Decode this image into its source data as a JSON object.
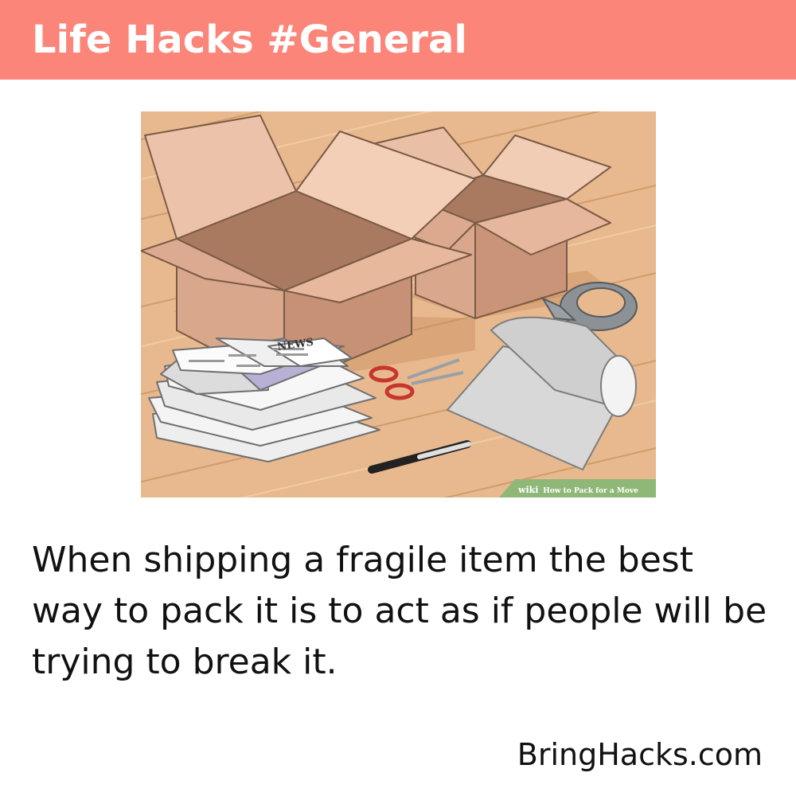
{
  "header": {
    "title": "Life Hacks #General",
    "color": "#fc857a"
  },
  "illustration": {
    "watermark_brand": "wiki",
    "watermark_text": "How to Pack for a Move",
    "newspaper_masthead": "NEWS"
  },
  "hack": {
    "text": "When shipping a fragile item the best way to pack it is to act as if people will be trying to break it."
  },
  "footer": {
    "site": "BringHacks.com"
  }
}
